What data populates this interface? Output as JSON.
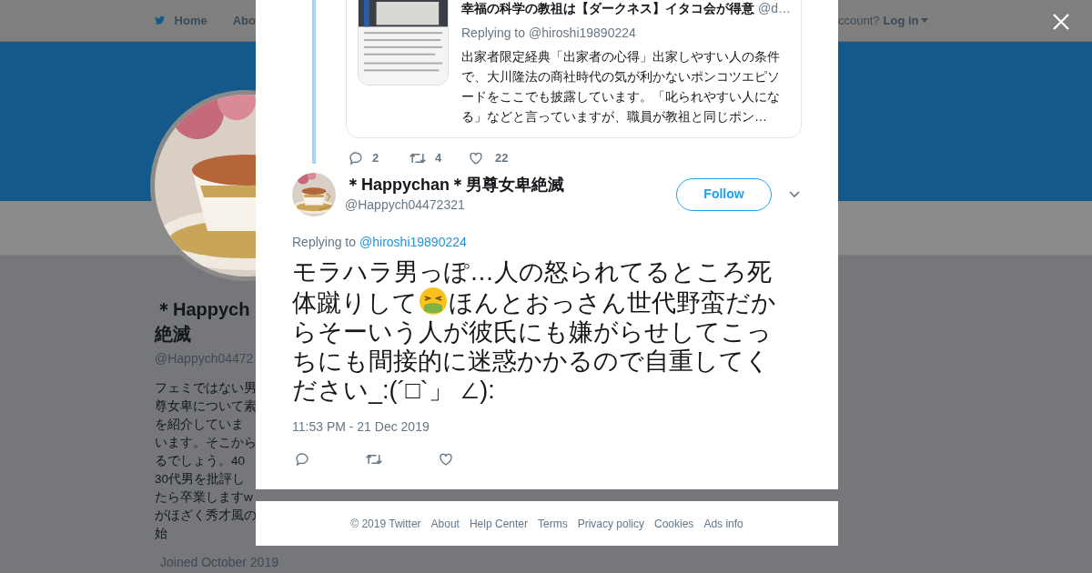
{
  "background": {
    "nav": {
      "home": "Home",
      "about": "Abo",
      "account": "ccount?",
      "login": "Log in"
    },
    "profile": {
      "name_lines": [
        "＊Happych",
        "絶滅"
      ],
      "handle": "@Happych04472",
      "bio_lines": [
        "フェミではない男",
        "尊女卑について素",
        "を紹介していま",
        "います。そこから",
        "るでしょう。40",
        "30代男を批評し",
        "たら卒業しますw",
        "がほざく秀才風の",
        "始"
      ],
      "joined": "Joined October 2019"
    }
  },
  "modal": {
    "quoted": {
      "title": "幸福の科学の教祖は【ダークネス】イタコ会が得意",
      "handle": "@d…",
      "replying_prefix": "Replying to",
      "replying_handle": "@hiroshi19890224",
      "text": "出家者限定経典「出家者の心得」出家しやすい人の条件で、大川隆法の商社時代の気が利かないポンコツエピソードをここでも披露しています。「叱られやすい人になる」などと言っていますが、職員が教祖と同じポン…"
    },
    "quoted_stats": {
      "replies": "2",
      "retweets": "4",
      "likes": "22"
    },
    "tweet": {
      "name": "＊Happychan＊男尊女卑絶滅",
      "handle": "@Happych04472321",
      "follow": "Follow",
      "replying_prefix": "Replying to",
      "replying_handle": "@hiroshi19890224",
      "text_parts": [
        {
          "kind": "text",
          "text": "モラハラ男っぽ…人の怒られてるところ死体蹴りして"
        },
        {
          "kind": "emoji"
        },
        {
          "kind": "text",
          "text": "ほんとおっさん世代野蛮だからそーいう人が彼氏にも嫌がらせしてこっちにも間接的に迷惑かかるので自重してください_:(´□`」 ∠):"
        }
      ],
      "time": "11:53 PM - 21 Dec 2019"
    }
  },
  "footer": [
    "© 2019 Twitter",
    "About",
    "Help Center",
    "Terms",
    "Privacy policy",
    "Cookies",
    "Ads info"
  ]
}
